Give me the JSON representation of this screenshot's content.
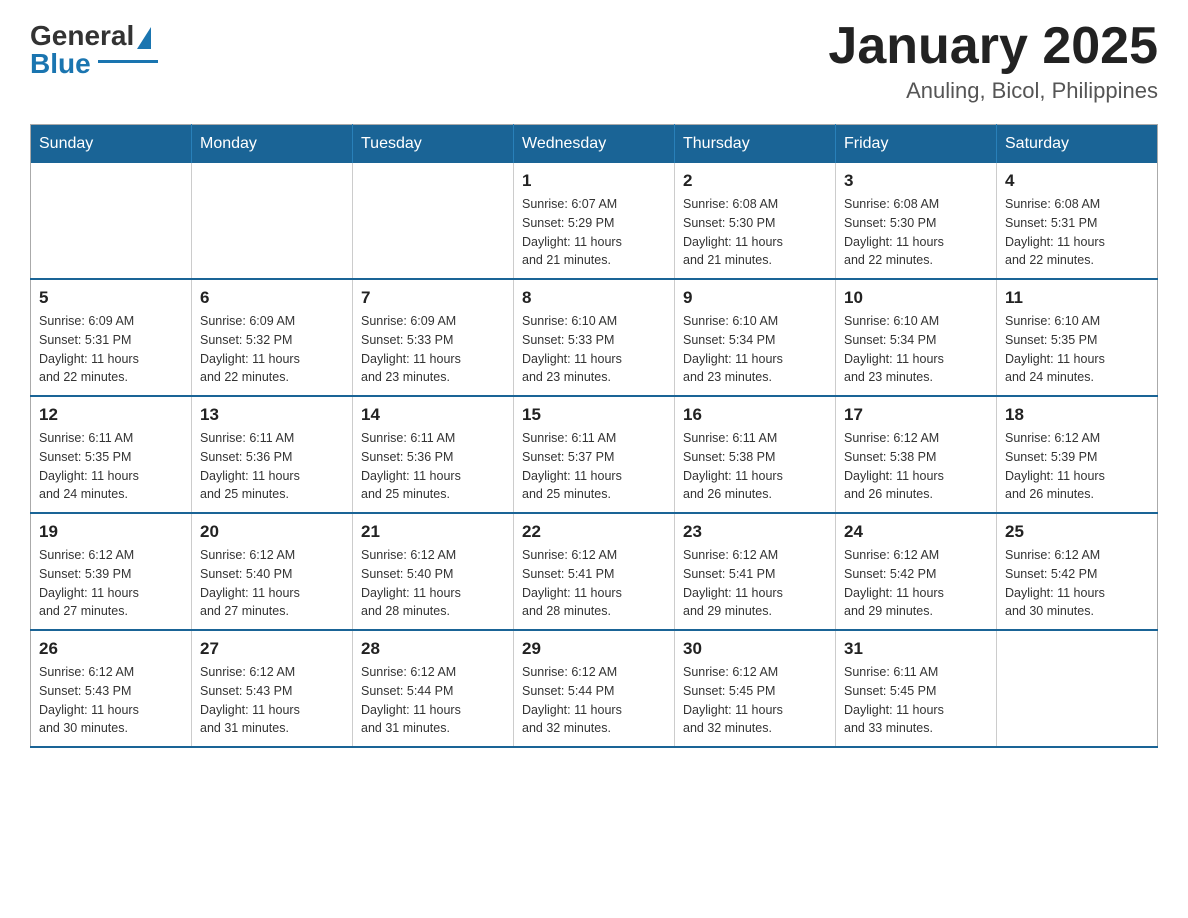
{
  "header": {
    "logo_general": "General",
    "logo_blue": "Blue",
    "month_title": "January 2025",
    "location": "Anuling, Bicol, Philippines"
  },
  "weekdays": [
    "Sunday",
    "Monday",
    "Tuesday",
    "Wednesday",
    "Thursday",
    "Friday",
    "Saturday"
  ],
  "weeks": [
    [
      {
        "day": "",
        "info": ""
      },
      {
        "day": "",
        "info": ""
      },
      {
        "day": "",
        "info": ""
      },
      {
        "day": "1",
        "info": "Sunrise: 6:07 AM\nSunset: 5:29 PM\nDaylight: 11 hours\nand 21 minutes."
      },
      {
        "day": "2",
        "info": "Sunrise: 6:08 AM\nSunset: 5:30 PM\nDaylight: 11 hours\nand 21 minutes."
      },
      {
        "day": "3",
        "info": "Sunrise: 6:08 AM\nSunset: 5:30 PM\nDaylight: 11 hours\nand 22 minutes."
      },
      {
        "day": "4",
        "info": "Sunrise: 6:08 AM\nSunset: 5:31 PM\nDaylight: 11 hours\nand 22 minutes."
      }
    ],
    [
      {
        "day": "5",
        "info": "Sunrise: 6:09 AM\nSunset: 5:31 PM\nDaylight: 11 hours\nand 22 minutes."
      },
      {
        "day": "6",
        "info": "Sunrise: 6:09 AM\nSunset: 5:32 PM\nDaylight: 11 hours\nand 22 minutes."
      },
      {
        "day": "7",
        "info": "Sunrise: 6:09 AM\nSunset: 5:33 PM\nDaylight: 11 hours\nand 23 minutes."
      },
      {
        "day": "8",
        "info": "Sunrise: 6:10 AM\nSunset: 5:33 PM\nDaylight: 11 hours\nand 23 minutes."
      },
      {
        "day": "9",
        "info": "Sunrise: 6:10 AM\nSunset: 5:34 PM\nDaylight: 11 hours\nand 23 minutes."
      },
      {
        "day": "10",
        "info": "Sunrise: 6:10 AM\nSunset: 5:34 PM\nDaylight: 11 hours\nand 23 minutes."
      },
      {
        "day": "11",
        "info": "Sunrise: 6:10 AM\nSunset: 5:35 PM\nDaylight: 11 hours\nand 24 minutes."
      }
    ],
    [
      {
        "day": "12",
        "info": "Sunrise: 6:11 AM\nSunset: 5:35 PM\nDaylight: 11 hours\nand 24 minutes."
      },
      {
        "day": "13",
        "info": "Sunrise: 6:11 AM\nSunset: 5:36 PM\nDaylight: 11 hours\nand 25 minutes."
      },
      {
        "day": "14",
        "info": "Sunrise: 6:11 AM\nSunset: 5:36 PM\nDaylight: 11 hours\nand 25 minutes."
      },
      {
        "day": "15",
        "info": "Sunrise: 6:11 AM\nSunset: 5:37 PM\nDaylight: 11 hours\nand 25 minutes."
      },
      {
        "day": "16",
        "info": "Sunrise: 6:11 AM\nSunset: 5:38 PM\nDaylight: 11 hours\nand 26 minutes."
      },
      {
        "day": "17",
        "info": "Sunrise: 6:12 AM\nSunset: 5:38 PM\nDaylight: 11 hours\nand 26 minutes."
      },
      {
        "day": "18",
        "info": "Sunrise: 6:12 AM\nSunset: 5:39 PM\nDaylight: 11 hours\nand 26 minutes."
      }
    ],
    [
      {
        "day": "19",
        "info": "Sunrise: 6:12 AM\nSunset: 5:39 PM\nDaylight: 11 hours\nand 27 minutes."
      },
      {
        "day": "20",
        "info": "Sunrise: 6:12 AM\nSunset: 5:40 PM\nDaylight: 11 hours\nand 27 minutes."
      },
      {
        "day": "21",
        "info": "Sunrise: 6:12 AM\nSunset: 5:40 PM\nDaylight: 11 hours\nand 28 minutes."
      },
      {
        "day": "22",
        "info": "Sunrise: 6:12 AM\nSunset: 5:41 PM\nDaylight: 11 hours\nand 28 minutes."
      },
      {
        "day": "23",
        "info": "Sunrise: 6:12 AM\nSunset: 5:41 PM\nDaylight: 11 hours\nand 29 minutes."
      },
      {
        "day": "24",
        "info": "Sunrise: 6:12 AM\nSunset: 5:42 PM\nDaylight: 11 hours\nand 29 minutes."
      },
      {
        "day": "25",
        "info": "Sunrise: 6:12 AM\nSunset: 5:42 PM\nDaylight: 11 hours\nand 30 minutes."
      }
    ],
    [
      {
        "day": "26",
        "info": "Sunrise: 6:12 AM\nSunset: 5:43 PM\nDaylight: 11 hours\nand 30 minutes."
      },
      {
        "day": "27",
        "info": "Sunrise: 6:12 AM\nSunset: 5:43 PM\nDaylight: 11 hours\nand 31 minutes."
      },
      {
        "day": "28",
        "info": "Sunrise: 6:12 AM\nSunset: 5:44 PM\nDaylight: 11 hours\nand 31 minutes."
      },
      {
        "day": "29",
        "info": "Sunrise: 6:12 AM\nSunset: 5:44 PM\nDaylight: 11 hours\nand 32 minutes."
      },
      {
        "day": "30",
        "info": "Sunrise: 6:12 AM\nSunset: 5:45 PM\nDaylight: 11 hours\nand 32 minutes."
      },
      {
        "day": "31",
        "info": "Sunrise: 6:11 AM\nSunset: 5:45 PM\nDaylight: 11 hours\nand 33 minutes."
      },
      {
        "day": "",
        "info": ""
      }
    ]
  ]
}
